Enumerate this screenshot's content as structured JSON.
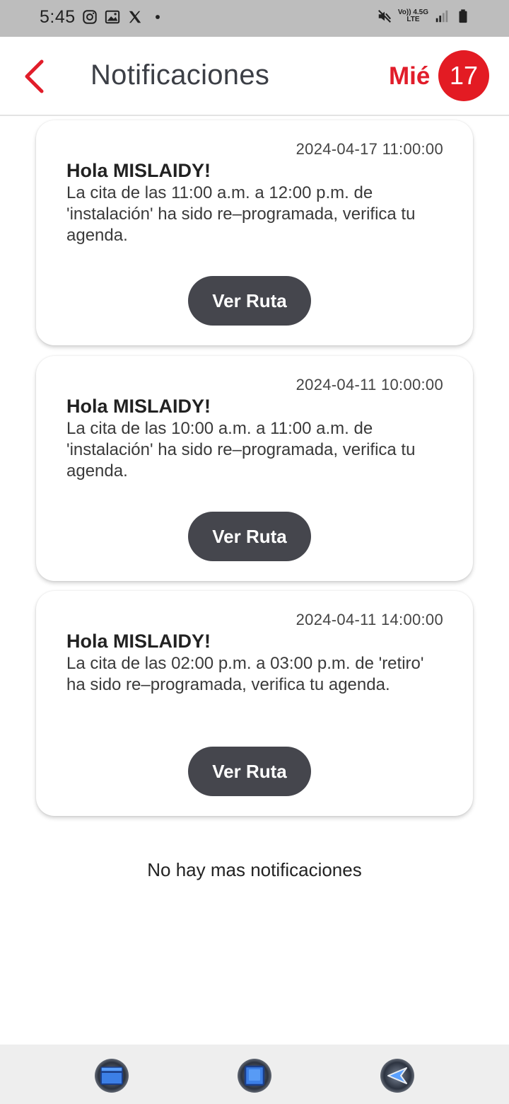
{
  "status_bar": {
    "time": "5:45",
    "network_top": "Vo)) 4.5G",
    "network_bottom": "LTE"
  },
  "header": {
    "title": "Notificaciones",
    "day_name": "Mié",
    "day_number": "17",
    "accent_color": "#e31b23"
  },
  "notifications": [
    {
      "date": "2024-04-17 11:00:00",
      "greeting": "Hola MISLAIDY!",
      "message": "La cita de las 11:00 a.m. a 12:00 p.m. de 'instalación' ha sido re–programada, verifica tu agenda.",
      "button_label": "Ver Ruta"
    },
    {
      "date": "2024-04-11 10:00:00",
      "greeting": "Hola MISLAIDY!",
      "message": "La cita de las 10:00 a.m. a 11:00 a.m. de 'instalación' ha sido re–programada, verifica tu agenda.",
      "button_label": "Ver Ruta"
    },
    {
      "date": "2024-04-11 14:00:00",
      "greeting": "Hola MISLAIDY!",
      "message": "La cita de las 02:00 p.m. a 03:00 p.m. de 'retiro' ha sido re–programada, verifica tu agenda.",
      "button_label": "Ver Ruta"
    }
  ],
  "footer_text": "No hay mas notificaciones",
  "nav_icons": [
    "recent-apps-icon",
    "home-icon",
    "back-icon"
  ]
}
